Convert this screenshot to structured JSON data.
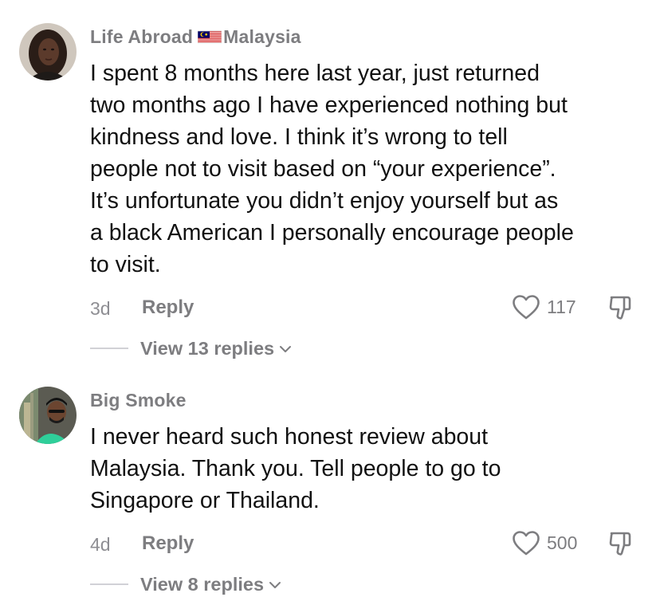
{
  "comments": [
    {
      "username": "Life Abroad",
      "flag_icon": "malaysia-flag-icon",
      "location": "Malaysia",
      "text": "I spent 8 months here last year, just returned\ntwo months ago I have experienced nothing but\nkindness and love. I think it’s wrong to tell\npeople not to visit based on “your experience”.\nIt’s unfortunate you didn’t enjoy yourself but as\na black American I personally encourage people\nto visit.",
      "time": "3d",
      "reply_label": "Reply",
      "likes": "117",
      "view_replies": "View 13 replies"
    },
    {
      "username": "Big Smoke",
      "text": "I never heard such honest review about\nMalaysia. Thank you. Tell people to go to\nSingapore or Thailand.",
      "time": "4d",
      "reply_label": "Reply",
      "likes": "500",
      "view_replies": "View 8 replies"
    }
  ],
  "colors": {
    "secondary_text": "#7d7d80",
    "primary_text": "#111111",
    "divider": "#d1d1d6"
  }
}
